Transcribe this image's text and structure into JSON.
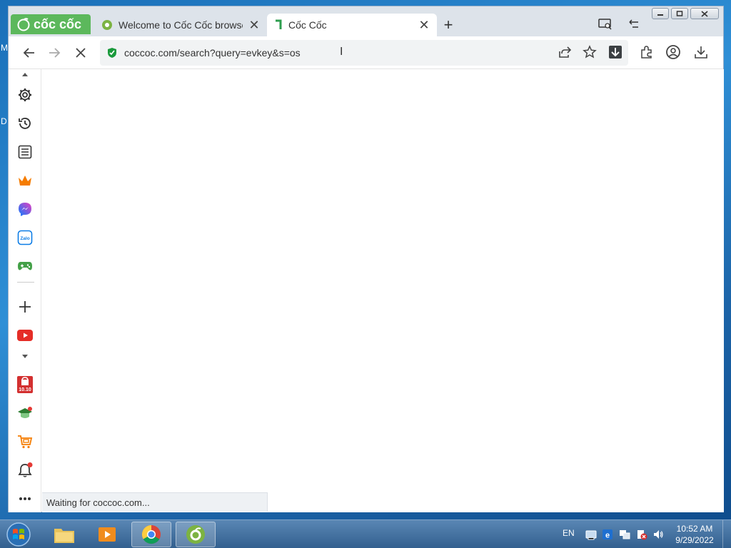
{
  "desktop": {
    "frag1": "M",
    "frag2": "D"
  },
  "browser": {
    "brand": "cốc cốc",
    "tabs": [
      {
        "label": "Welcome to Cốc Cốc browse"
      },
      {
        "label": "Cốc Cốc"
      }
    ],
    "address": "coccoc.com/search?query=evkey&s=os",
    "status_text": "Waiting for coccoc.com..."
  },
  "sidebar": {
    "items": [
      "settings-icon",
      "history-icon",
      "reading-list-icon",
      "crown-icon",
      "messenger-icon",
      "zalo-icon",
      "games-icon",
      "add-icon",
      "youtube-icon",
      "shopee-icon",
      "education-icon",
      "shopping-cart-icon",
      "notifications-icon",
      "more-icon"
    ],
    "zalo_label": "Zalo",
    "sale_label": "10.10"
  },
  "taskbar": {
    "language": "EN",
    "time": "10:52 AM",
    "date": "9/29/2022"
  },
  "colors": {
    "accent_green": "#5cb85c",
    "lock_green": "#1a9a3c",
    "download_blue": "#3c4043"
  }
}
